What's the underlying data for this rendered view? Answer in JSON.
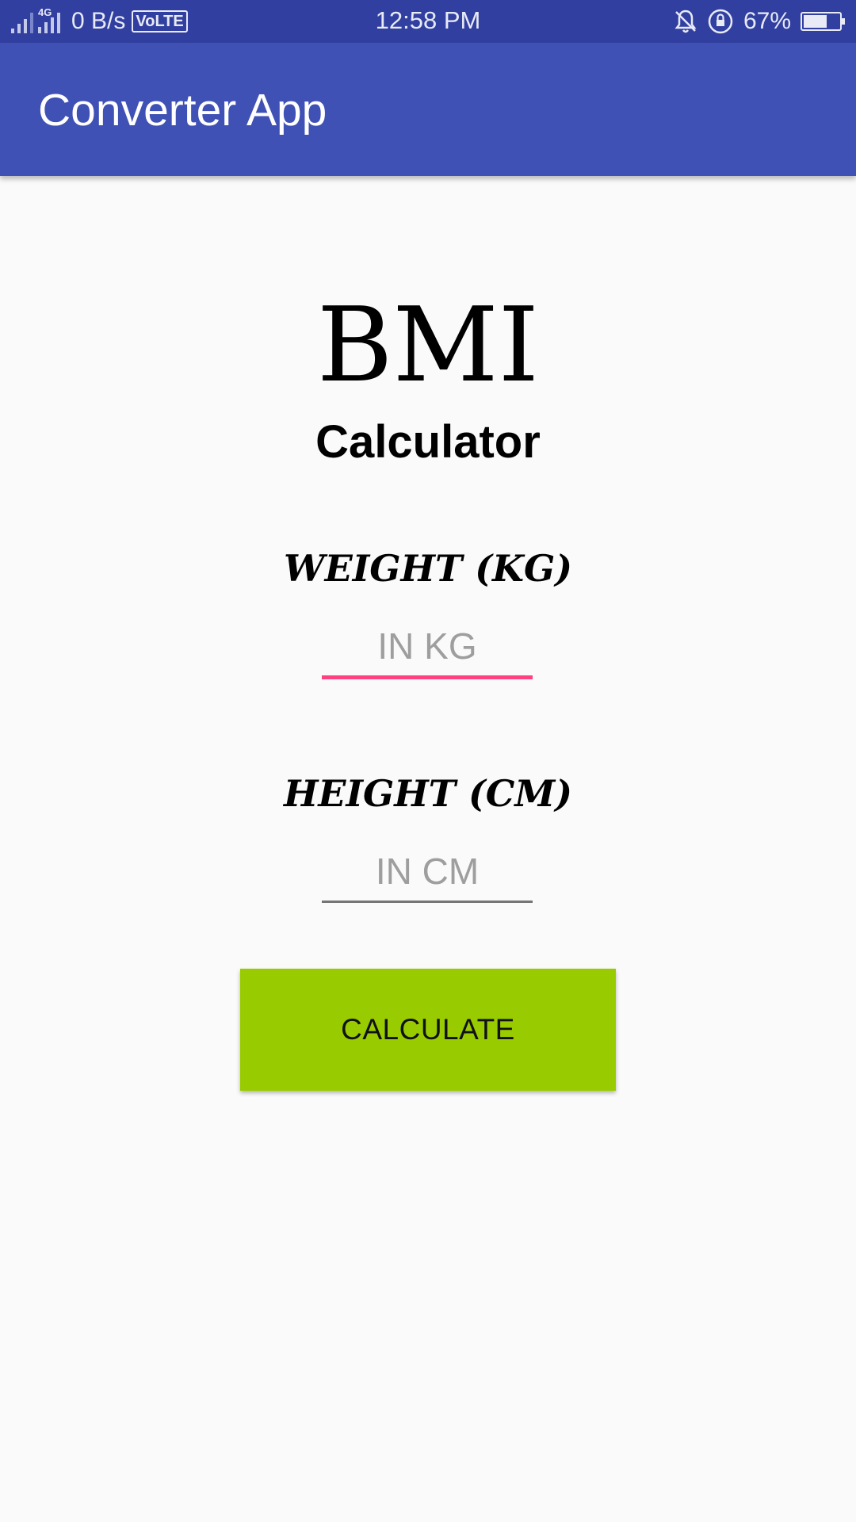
{
  "status_bar": {
    "network_type": "4G",
    "data_speed": "0 B/s",
    "volte_badge": "VoLTE",
    "time": "12:58 PM",
    "battery_percent": "67%",
    "battery_level": 0.67,
    "icons": [
      "signal-icon",
      "signal-4g-icon",
      "notifications-off-icon",
      "screen-rotation-lock-icon",
      "battery-icon"
    ]
  },
  "app_bar": {
    "title": "Converter App",
    "color": "#3f51b5"
  },
  "header": {
    "title": "BMI",
    "subtitle": "Calculator"
  },
  "form": {
    "weight_label": "WEIGHT (KG)",
    "weight_placeholder": "IN KG",
    "weight_value": "",
    "height_label": "HEIGHT (CM)",
    "height_placeholder": "IN CM",
    "height_value": "",
    "focused_underline_color": "#ff4081",
    "unfocused_underline_color": "#757575"
  },
  "actions": {
    "calculate_label": "CALCULATE",
    "button_color": "#99cc00"
  }
}
